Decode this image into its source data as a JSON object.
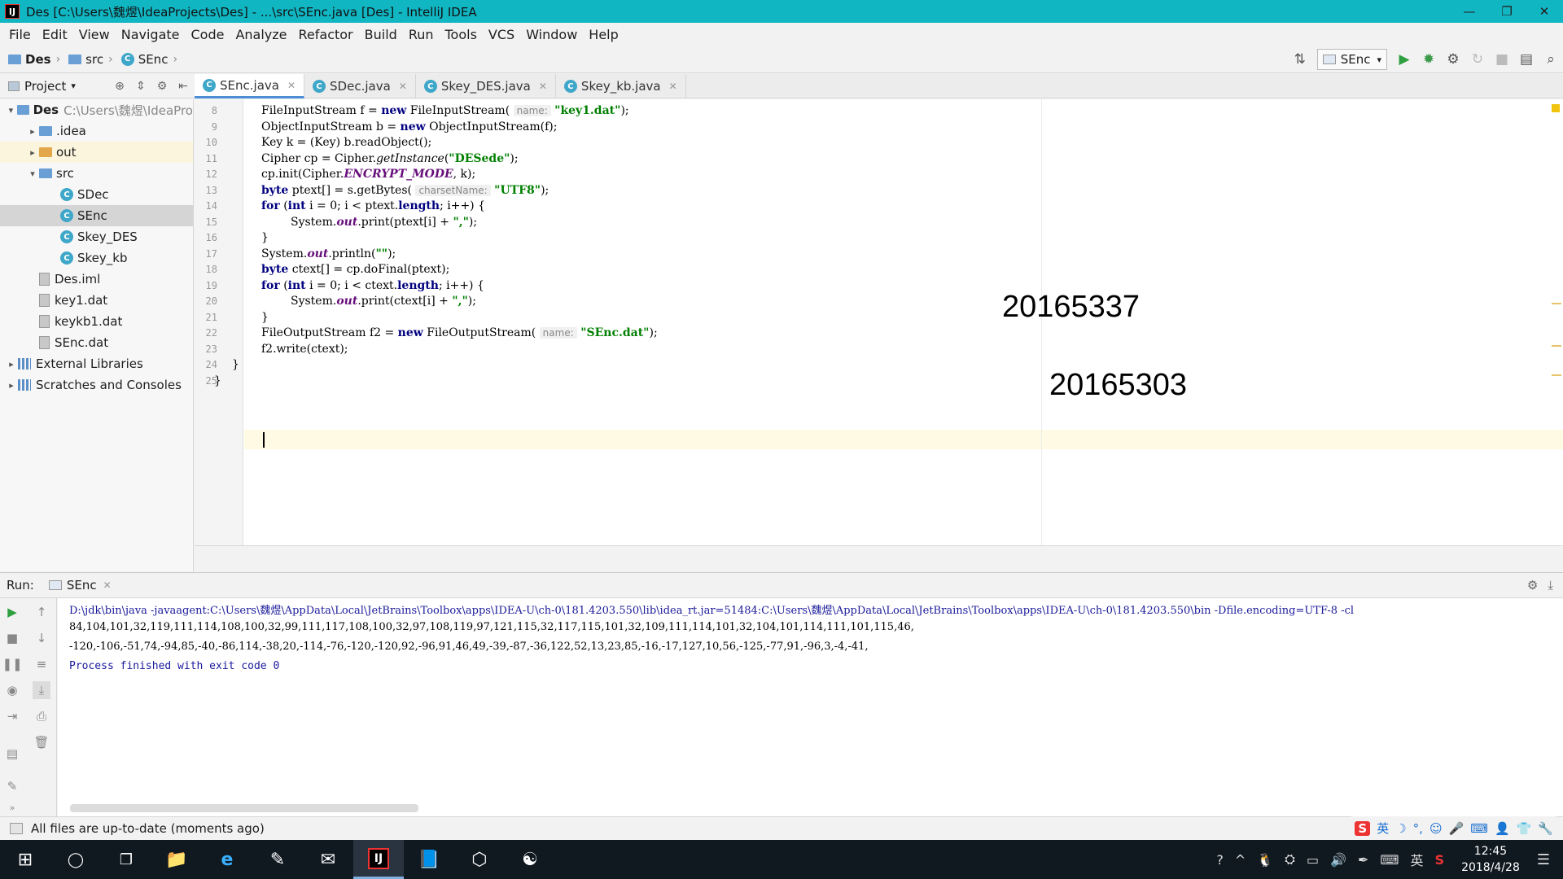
{
  "window": {
    "title": "Des [C:\\Users\\魏煜\\IdeaProjects\\Des] - ...\\src\\SEnc.java [Des] - IntelliJ IDEA",
    "minimize": "—",
    "restore": "❐",
    "close": "✕"
  },
  "menu": [
    "File",
    "Edit",
    "View",
    "Navigate",
    "Code",
    "Analyze",
    "Refactor",
    "Build",
    "Run",
    "Tools",
    "VCS",
    "Window",
    "Help"
  ],
  "breadcrumb": [
    "Des",
    "src",
    "SEnc"
  ],
  "run_config": "SEnc",
  "project_panel": {
    "title": "Project",
    "tree": [
      {
        "label": "Des",
        "extra": "C:\\Users\\魏煜\\IdeaPro",
        "indent": 0,
        "arrow": "▾",
        "type": "folder"
      },
      {
        "label": ".idea",
        "indent": 1,
        "arrow": "▸",
        "type": "folder"
      },
      {
        "label": "out",
        "indent": 1,
        "arrow": "▸",
        "type": "folder-orange",
        "state": "highlight"
      },
      {
        "label": "src",
        "indent": 1,
        "arrow": "▾",
        "type": "folder"
      },
      {
        "label": "SDec",
        "indent": 2,
        "arrow": "",
        "type": "class"
      },
      {
        "label": "SEnc",
        "indent": 2,
        "arrow": "",
        "type": "class",
        "state": "selected"
      },
      {
        "label": "Skey_DES",
        "indent": 2,
        "arrow": "",
        "type": "class"
      },
      {
        "label": "Skey_kb",
        "indent": 2,
        "arrow": "",
        "type": "class"
      },
      {
        "label": "Des.iml",
        "indent": 1,
        "arrow": "",
        "type": "file"
      },
      {
        "label": "key1.dat",
        "indent": 1,
        "arrow": "",
        "type": "file"
      },
      {
        "label": "keykb1.dat",
        "indent": 1,
        "arrow": "",
        "type": "file"
      },
      {
        "label": "SEnc.dat",
        "indent": 1,
        "arrow": "",
        "type": "file"
      },
      {
        "label": "External Libraries",
        "indent": 0,
        "arrow": "▸",
        "type": "lib"
      },
      {
        "label": "Scratches and Consoles",
        "indent": 0,
        "arrow": "▸",
        "type": "lib"
      }
    ]
  },
  "tabs": [
    {
      "label": "SEnc.java",
      "active": true
    },
    {
      "label": "SDec.java",
      "active": false
    },
    {
      "label": "Skey_DES.java",
      "active": false
    },
    {
      "label": "Skey_kb.java",
      "active": false
    }
  ],
  "code": [
    {
      "n": "8",
      "html": "FileInputStream f = <span class=\"kw\">new</span> FileInputStream( <span class=\"hint\">name:</span> <span class=\"str\">\"key1.dat\"</span>);"
    },
    {
      "n": "9",
      "html": "ObjectInputStream b = <span class=\"kw\">new</span> ObjectInputStream(f);"
    },
    {
      "n": "10",
      "html": "Key k = (Key) b.readObject();"
    },
    {
      "n": "11",
      "html": "Cipher cp = Cipher.<span class=\"ital\">getInstance</span>(<span class=\"str\">\"DESede\"</span>);"
    },
    {
      "n": "12",
      "html": "cp.init(Cipher.<span class=\"fld\">ENCRYPT_MODE</span>, k);"
    },
    {
      "n": "13",
      "html": "<span class=\"kw\">byte</span> ptext[] = s.getBytes( <span class=\"hint\">charsetName:</span> <span class=\"str\">\"UTF8\"</span>);"
    },
    {
      "n": "14",
      "html": "<span class=\"kw\">for</span> (<span class=\"kw\">int</span> i = 0; i &lt; ptext.<span class=\"kw\">length</span>; i++) {"
    },
    {
      "n": "15",
      "html": "    System.<span class=\"fld\">out</span>.print(ptext[i] + <span class=\"str\">\",\"</span>);"
    },
    {
      "n": "16",
      "html": "}"
    },
    {
      "n": "17",
      "html": "System.<span class=\"fld\">out</span>.println(<span class=\"str\">\"\"</span>);"
    },
    {
      "n": "18",
      "html": "<span class=\"kw\">byte</span> ctext[] = cp.doFinal(ptext);"
    },
    {
      "n": "19",
      "html": "<span class=\"kw\">for</span> (<span class=\"kw\">int</span> i = 0; i &lt; ctext.<span class=\"kw\">length</span>; i++) {"
    },
    {
      "n": "20",
      "html": "    System.<span class=\"fld\">out</span>.print(ctext[i] + <span class=\"str\">\",\"</span>);"
    },
    {
      "n": "21",
      "html": "}"
    },
    {
      "n": "22",
      "html": "FileOutputStream f2 = <span class=\"kw\">new</span> FileOutputStream( <span class=\"hint\">name:</span> <span class=\"str\">\"SEnc.dat\"</span>);"
    },
    {
      "n": "23",
      "html": "f2.write(ctext);"
    },
    {
      "n": "24",
      "html": "}"
    },
    {
      "n": "25",
      "html": "}"
    }
  ],
  "annotations": [
    "20165337",
    "20165303"
  ],
  "run": {
    "label": "Run:",
    "tab": "SEnc",
    "console": [
      "D:\\jdk\\bin\\java -javaagent:C:\\Users\\魏煜\\AppData\\Local\\JetBrains\\Toolbox\\apps\\IDEA-U\\ch-0\\181.4203.550\\lib\\idea_rt.jar=51484:C:\\Users\\魏煜\\AppData\\Local\\JetBrains\\Toolbox\\apps\\IDEA-U\\ch-0\\181.4203.550\\bin -Dfile.encoding=UTF-8 -cl",
      "84,104,101,32,119,111,114,108,100,32,99,111,117,108,100,32,97,108,119,97,121,115,32,117,115,101,32,109,111,114,101,32,104,101,114,111,101,115,46,",
      "-120,-106,-51,74,-94,85,-40,-86,114,-38,20,-114,-76,-120,-120,92,-96,91,46,49,-39,-87,-36,122,52,13,23,85,-16,-17,127,10,56,-125,-77,91,-96,3,-4,-41,",
      "Process finished with exit code 0"
    ]
  },
  "status": "All files are up-to-date (moments ago)",
  "ime": [
    "S",
    "英",
    "☽",
    "°,",
    "☺",
    "🎤",
    "⌨",
    "👤",
    "👕",
    "🔧"
  ],
  "taskbar": {
    "apps": [
      "⊞",
      "◯",
      "❐",
      "📁",
      "e",
      "✎",
      "✉",
      "IJ",
      "📘",
      "⬡",
      "☯"
    ],
    "tray": [
      "?",
      "^",
      "🐧",
      "⛭",
      "▭",
      "🔊",
      "✒",
      "⌨",
      "英",
      "S"
    ],
    "time": "12:45",
    "date": "2018/4/28",
    "notifications": "☰"
  }
}
